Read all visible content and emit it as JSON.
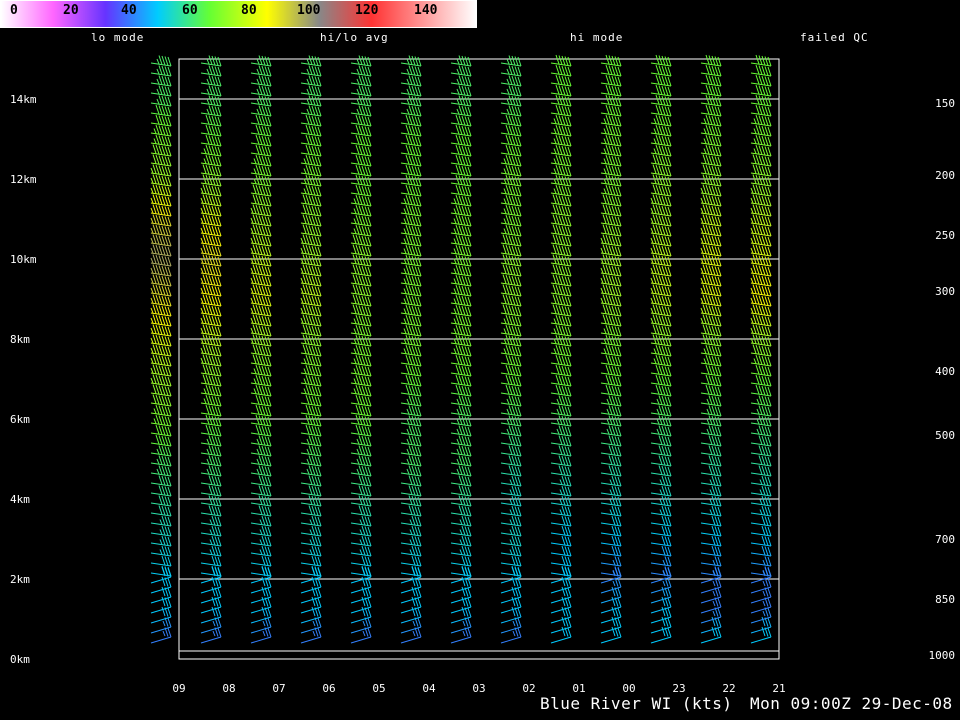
{
  "legend": {
    "labels": [
      "0",
      "20",
      "40",
      "60",
      "80",
      "100",
      "120",
      "140"
    ],
    "stops": [
      "#ffffff",
      "#ff66ff",
      "#6633ff",
      "#00ccff",
      "#66ff33",
      "#ffff00",
      "#888888",
      "#ff3333",
      "#ff9999",
      "#ffffff"
    ]
  },
  "modes": {
    "lo": "lo mode",
    "hilo": "hi/lo avg",
    "hi": "hi mode",
    "failed": "failed QC"
  },
  "footer": {
    "station": "Blue River WI (kts)",
    "time": "Mon 09:00Z 29-Dec-08"
  },
  "chart_data": {
    "type": "wind_profile",
    "units": "kts",
    "x_time_labels": [
      "09",
      "08",
      "07",
      "06",
      "05",
      "04",
      "03",
      "02",
      "01",
      "00",
      "23",
      "22",
      "21"
    ],
    "y_height_labels": [
      "0km",
      "2km",
      "4km",
      "6km",
      "8km",
      "10km",
      "12km",
      "14km"
    ],
    "y_height_km": [
      0,
      2,
      4,
      6,
      8,
      10,
      12,
      14
    ],
    "pressure_labels": [
      "150",
      "200",
      "250",
      "300",
      "400",
      "500",
      "700",
      "850",
      "1000"
    ],
    "pressure_hpa": [
      150,
      200,
      250,
      300,
      400,
      500,
      700,
      850,
      1000
    ],
    "pressure_height_km": [
      13.9,
      12.1,
      10.6,
      9.2,
      7.2,
      5.6,
      3.0,
      1.5,
      0.1
    ],
    "grid": true,
    "speed_profile_kts": {
      "height_km": [
        0.5,
        1.0,
        2.0,
        3.0,
        4.0,
        5.0,
        6.0,
        7.0,
        8.0,
        9.0,
        10.0,
        11.0,
        12.0,
        13.0,
        14.0
      ],
      "by_time": [
        [
          25,
          30,
          30,
          35,
          40,
          45,
          55,
          65,
          75,
          85,
          95,
          85,
          65,
          55,
          45
        ],
        [
          25,
          30,
          30,
          35,
          40,
          45,
          50,
          60,
          70,
          80,
          85,
          75,
          60,
          50,
          45
        ],
        [
          25,
          30,
          30,
          35,
          40,
          45,
          50,
          55,
          65,
          75,
          70,
          65,
          55,
          50,
          45
        ],
        [
          25,
          30,
          30,
          35,
          40,
          45,
          50,
          55,
          60,
          70,
          65,
          60,
          55,
          50,
          45
        ],
        [
          25,
          30,
          30,
          35,
          40,
          45,
          50,
          55,
          55,
          60,
          60,
          55,
          50,
          50,
          45
        ],
        [
          25,
          30,
          30,
          35,
          40,
          45,
          45,
          50,
          55,
          55,
          55,
          55,
          50,
          50,
          45
        ],
        [
          25,
          30,
          30,
          35,
          40,
          45,
          45,
          50,
          55,
          55,
          55,
          55,
          50,
          50,
          45
        ],
        [
          25,
          30,
          30,
          35,
          35,
          40,
          45,
          50,
          55,
          60,
          60,
          55,
          55,
          50,
          45
        ],
        [
          30,
          30,
          30,
          30,
          35,
          40,
          45,
          50,
          55,
          60,
          60,
          60,
          55,
          55,
          50
        ],
        [
          30,
          30,
          25,
          30,
          35,
          40,
          45,
          50,
          55,
          65,
          65,
          60,
          55,
          55,
          50
        ],
        [
          30,
          30,
          25,
          30,
          35,
          40,
          45,
          50,
          60,
          70,
          70,
          65,
          60,
          55,
          50
        ],
        [
          30,
          25,
          25,
          30,
          35,
          40,
          45,
          50,
          60,
          75,
          75,
          70,
          60,
          55,
          50
        ],
        [
          30,
          25,
          25,
          30,
          35,
          40,
          45,
          50,
          65,
          80,
          75,
          70,
          60,
          55,
          50
        ]
      ]
    }
  }
}
